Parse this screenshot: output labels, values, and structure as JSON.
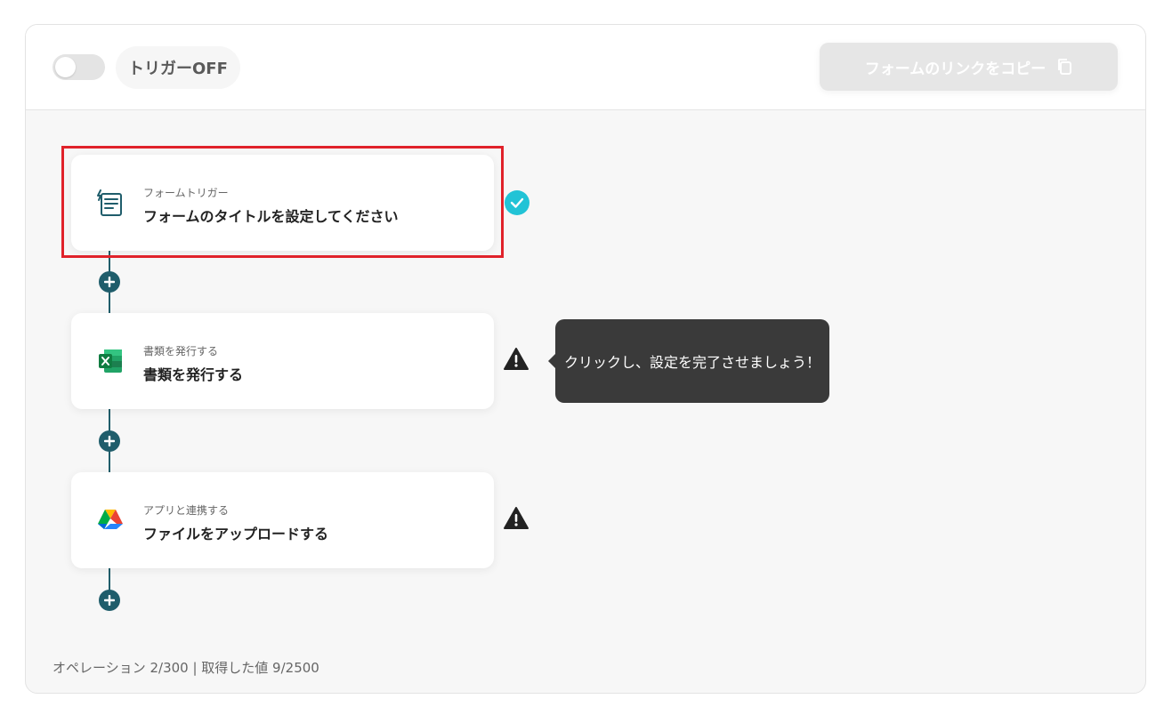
{
  "header": {
    "trigger_label": "トリガーOFF",
    "copy_button_label": "フォームのリンクをコピー"
  },
  "steps": [
    {
      "subtitle": "フォームトリガー",
      "title": "フォームのタイトルを設定してください",
      "icon": "form-icon",
      "status": "check-icon"
    },
    {
      "subtitle": "書類を発行する",
      "title": "書類を発行する",
      "icon": "excel-icon",
      "status": "warning-icon"
    },
    {
      "subtitle": "アプリと連携する",
      "title": "ファイルをアップロードする",
      "icon": "google-drive-icon",
      "status": "warning-icon"
    }
  ],
  "tooltip": {
    "text": "クリックし、設定を完了させましょう！"
  },
  "footer": {
    "text": "オペレーション 2/300 | 取得した値 9/2500"
  },
  "colors": {
    "accent": "#1f5d6b",
    "check": "#22c3d6",
    "highlight": "#e0222a",
    "tooltip_bg": "#3a3a3a"
  }
}
